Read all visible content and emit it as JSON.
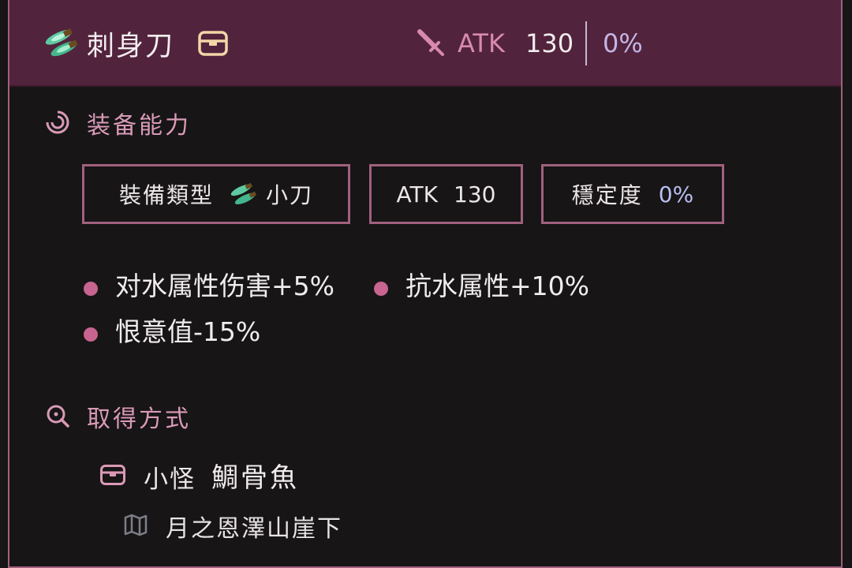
{
  "header": {
    "item_name": "刺身刀",
    "atk_label": "ATK",
    "atk_value": "130",
    "stability_value": "0%"
  },
  "equip_section": {
    "title": "装备能力",
    "chips": {
      "type_label": "裝備類型",
      "type_value": "小刀",
      "atk_label": "ATK",
      "atk_value": "130",
      "stability_label": "穩定度",
      "stability_value": "0%"
    },
    "effects": [
      "对水属性伤害+5%",
      "抗水属性+10%",
      "恨意值-15%"
    ]
  },
  "obtain_section": {
    "title": "取得方式",
    "source_type": "小怪",
    "source_name": "鯛骨魚",
    "location": "月之恩澤山崖下"
  },
  "icons": {
    "item": "knife-icon",
    "chest": "chest-icon",
    "attack": "sword-icon",
    "equip": "swirl-icon",
    "search": "search-icon",
    "map": "map-icon"
  },
  "colors": {
    "header_bg": "#52233c",
    "accent": "#a0607e",
    "section_title": "#d99ab6",
    "stability_blue": "#c3b5e6"
  }
}
